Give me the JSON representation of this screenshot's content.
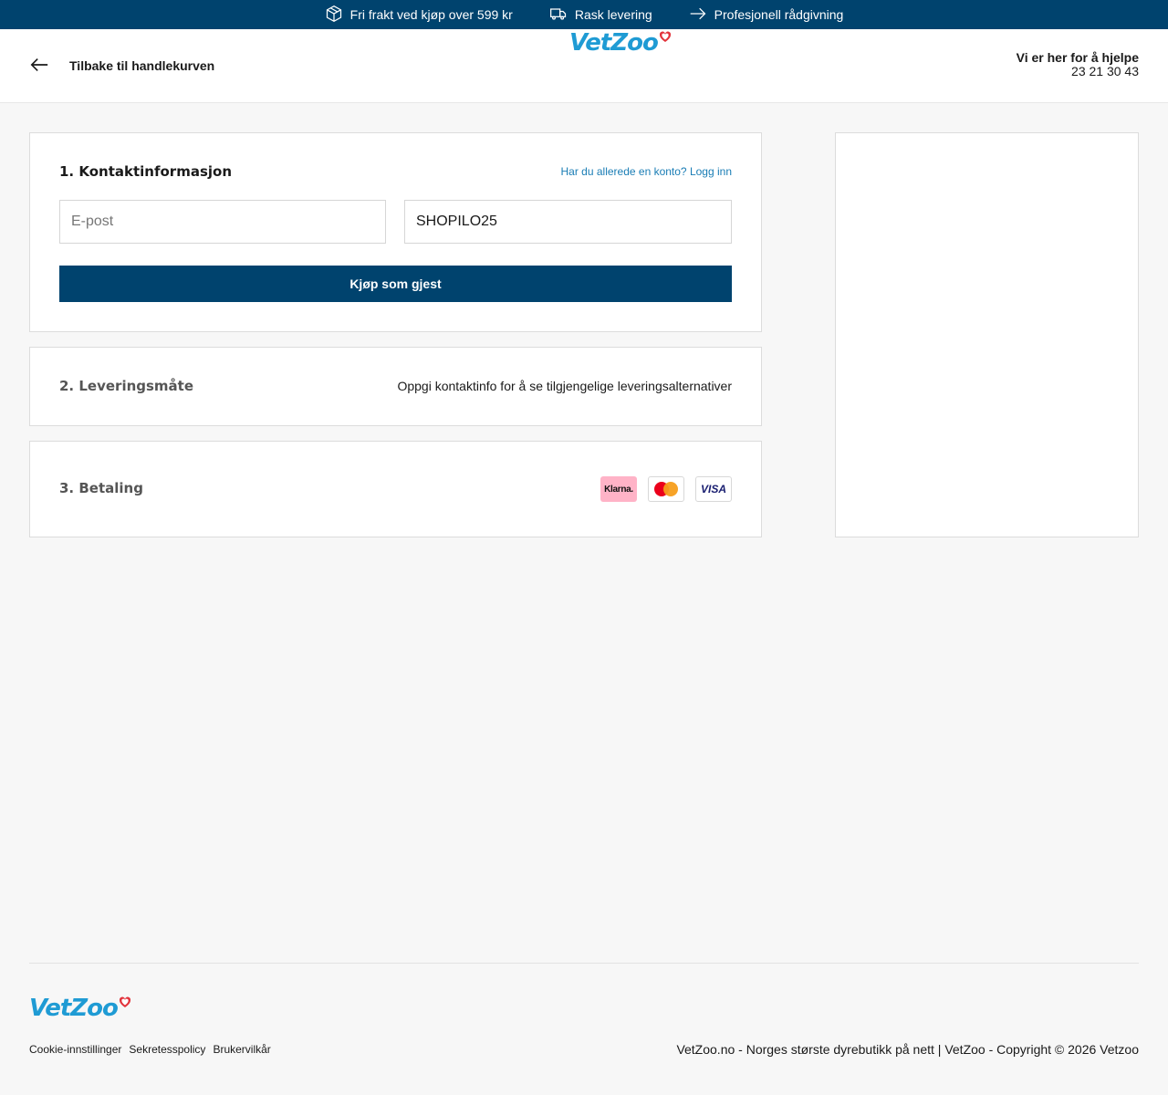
{
  "topbar": {
    "usps": [
      {
        "icon": "package-icon",
        "label": "Fri frakt ved kjøp over 599 kr"
      },
      {
        "icon": "truck-icon",
        "label": "Rask levering"
      },
      {
        "icon": "arrow-right-icon",
        "label": "Profesjonell rådgivning"
      }
    ]
  },
  "header": {
    "back_label": "Tilbake til handlekurven",
    "logo": "VetZoo",
    "help_title": "Vi er her for å hjelpe",
    "help_phone": "23 21 30 43"
  },
  "contact": {
    "title": "1. Kontaktinformasjon",
    "login_link": "Har du allerede en konto? Logg inn",
    "email_placeholder": "E-post",
    "code_value": "SHOPILO25",
    "guest_button": "Kjøp som gjest"
  },
  "delivery": {
    "title": "2. Leveringsmåte",
    "info": "Oppgi kontaktinfo for å se tilgjengelige leveringsalternativer"
  },
  "payment": {
    "title": "3. Betaling",
    "methods": [
      {
        "icon": "klarna-icon",
        "label": "Klarna."
      },
      {
        "icon": "mastercard-icon",
        "label": ""
      },
      {
        "icon": "visa-icon",
        "label": "VISA"
      }
    ]
  },
  "footer": {
    "logo": "VetZoo",
    "links": [
      "Cookie-innstillinger",
      "Sekretesspolicy",
      "Brukervilkår"
    ],
    "copyright": "VetZoo.no - Norges største dyrebutikk på nett | VetZoo - Copyright © 2026 Vetzoo"
  },
  "colors": {
    "brand_dark": "#00436e",
    "brand_blue": "#1f9bd4",
    "heart_red": "#e2333b",
    "link": "#1a7db5"
  }
}
